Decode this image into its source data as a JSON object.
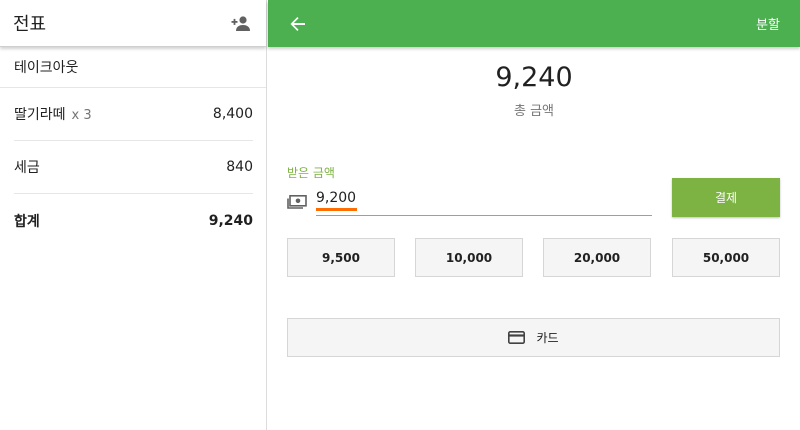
{
  "ticket": {
    "title": "전표",
    "order_type": "테이크아웃",
    "items": [
      {
        "name": "딸기라떼",
        "qty": "x 3",
        "price": "8,400"
      },
      {
        "name": "세금",
        "qty": "",
        "price": "840"
      }
    ],
    "total_label": "합계",
    "total_value": "9,240"
  },
  "payment": {
    "split_label": "분할",
    "amount": "9,240",
    "amount_label": "총 금액",
    "received_label": "받은 금액",
    "received_value": "9,200",
    "pay_button": "결제",
    "quick_amounts": [
      "9,500",
      "10,000",
      "20,000",
      "50,000"
    ],
    "card_label": "카드"
  },
  "colors": {
    "accent": "#4caf50",
    "pay": "#7cb342",
    "cursor": "#ff6d00"
  },
  "icons": [
    "add-person-icon",
    "arrow-back-icon",
    "cash-icon",
    "credit-card-icon"
  ]
}
